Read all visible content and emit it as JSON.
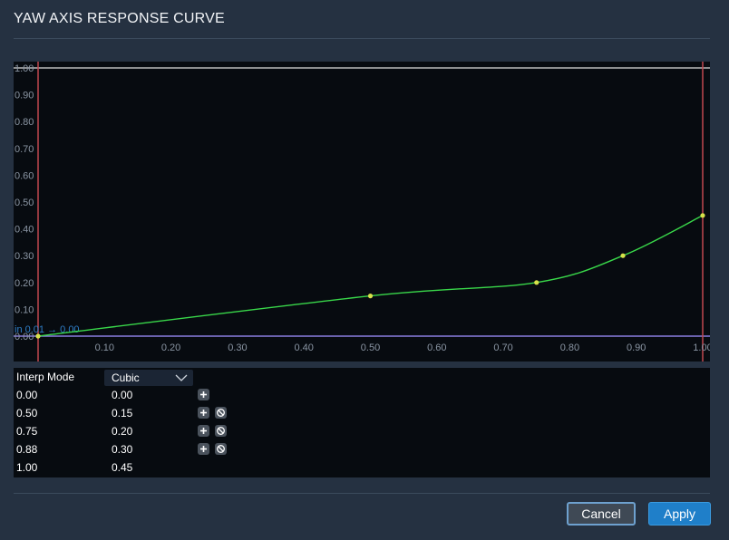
{
  "dialog": {
    "title": "YAW AXIS RESPONSE CURVE",
    "cancel_label": "Cancel",
    "apply_label": "Apply"
  },
  "colors": {
    "background": "#253141",
    "plot_bg": "#070b10",
    "curve": "#39d84a",
    "keyframe": "#d6e24a",
    "top_line": "#b9b9b9",
    "bottom_line": "#8a7ee0",
    "side_lines": "#c0474f",
    "apply_accent": "#1f7fc9",
    "hint": "#2f7fc8"
  },
  "plot": {
    "y_ticks": [
      "1.00",
      "0.90",
      "0.80",
      "0.70",
      "0.60",
      "0.50",
      "0.40",
      "0.30",
      "0.20",
      "0.10",
      "0.00"
    ],
    "x_ticks": [
      "0.10",
      "0.20",
      "0.30",
      "0.40",
      "0.50",
      "0.60",
      "0.70",
      "0.80",
      "0.90",
      "1.00"
    ],
    "hint": "in 0.01 → 0.00"
  },
  "chart_data": {
    "type": "line",
    "x": [
      0.0,
      0.5,
      0.75,
      0.88,
      1.0
    ],
    "y": [
      0.0,
      0.15,
      0.2,
      0.3,
      0.45
    ],
    "xlim": [
      0,
      1
    ],
    "ylim": [
      0,
      1
    ],
    "interpolation": "cubic"
  },
  "table": {
    "mode_label": "Interp Mode",
    "mode_value": "Cubic",
    "rows": [
      {
        "x": "0.00",
        "y": "0.00",
        "add": true,
        "remove": false
      },
      {
        "x": "0.50",
        "y": "0.15",
        "add": true,
        "remove": true
      },
      {
        "x": "0.75",
        "y": "0.20",
        "add": true,
        "remove": true
      },
      {
        "x": "0.88",
        "y": "0.30",
        "add": true,
        "remove": true
      },
      {
        "x": "1.00",
        "y": "0.45",
        "add": false,
        "remove": false
      }
    ]
  }
}
